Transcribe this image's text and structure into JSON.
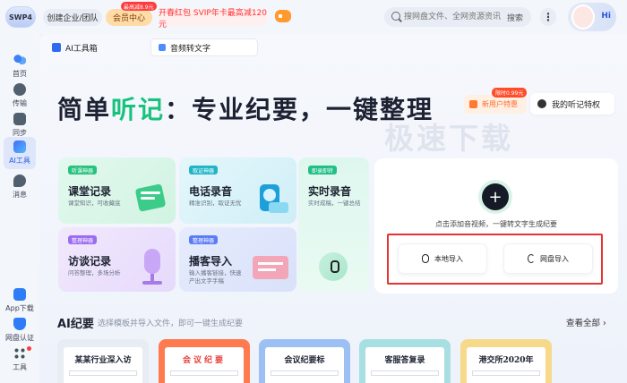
{
  "topbar": {
    "logo": "SWP4",
    "team_label": "创建企业/团队",
    "vip_label": "会员中心",
    "vip_tag": "最高减8.9元",
    "promo_label": "开春红包 SVIP年卡最高减120元",
    "search_placeholder": "搜网盘文件、全网资源资讯",
    "search_button": "搜索",
    "avatar_greeting": "Hi"
  },
  "sidebar": {
    "items": [
      {
        "label": "首页",
        "icon": "cloud-icon"
      },
      {
        "label": "传输",
        "icon": "transfer-icon"
      },
      {
        "label": "同步",
        "icon": "sync-icon"
      },
      {
        "label": "AI工具",
        "icon": "ai-tools-icon"
      },
      {
        "label": "消息",
        "icon": "message-icon"
      },
      {
        "label": "App下载",
        "icon": "app-download-icon"
      },
      {
        "label": "网盘认证",
        "icon": "certification-icon"
      },
      {
        "label": "工具",
        "icon": "tools-icon"
      }
    ]
  },
  "tabs": {
    "ai_toolbox": "AI工具箱",
    "audio_to_text": "音频转文字"
  },
  "hero": {
    "title_pre": "简单",
    "title_highlight": "听记",
    "title_post": "：专业纪要，一键整理",
    "watermark": "极速下载",
    "new_user_limit": "限时0.99元",
    "new_user_label": "新用户特惠",
    "privilege_label": "我的听记特权"
  },
  "cards": {
    "classroom": {
      "badge": "听课神器",
      "title": "课堂记录",
      "sub": "课堂知识，可收藏底"
    },
    "phone": {
      "badge": "取证神器",
      "title": "电话录音",
      "sub": "精准识别，取证无忧"
    },
    "live": {
      "badge": "即录即转",
      "title": "实时录音",
      "sub": "实时成稿，一键总结"
    },
    "interview": {
      "badge": "整理神器",
      "title": "访谈记录",
      "sub": "问答整理，多场分析"
    },
    "podcast": {
      "badge": "整理神器",
      "title": "播客导入",
      "sub": "输入播客链接，快速产出文字手稿"
    }
  },
  "upload": {
    "hint": "点击添加音视频，一键转文字生成纪要",
    "local_label": "本地导入",
    "cloud_label": "网盘导入"
  },
  "minutes": {
    "title": "AI纪要",
    "subtitle": "选择模板并导入文件，即可一键生成纪要",
    "see_all": "查看全部 ›",
    "templates": [
      {
        "title": "某某行业深入访"
      },
      {
        "title": "会议纪要"
      },
      {
        "title": "会议纪要标"
      },
      {
        "title": "客服答复录"
      },
      {
        "title": "港交所2020年"
      }
    ]
  }
}
